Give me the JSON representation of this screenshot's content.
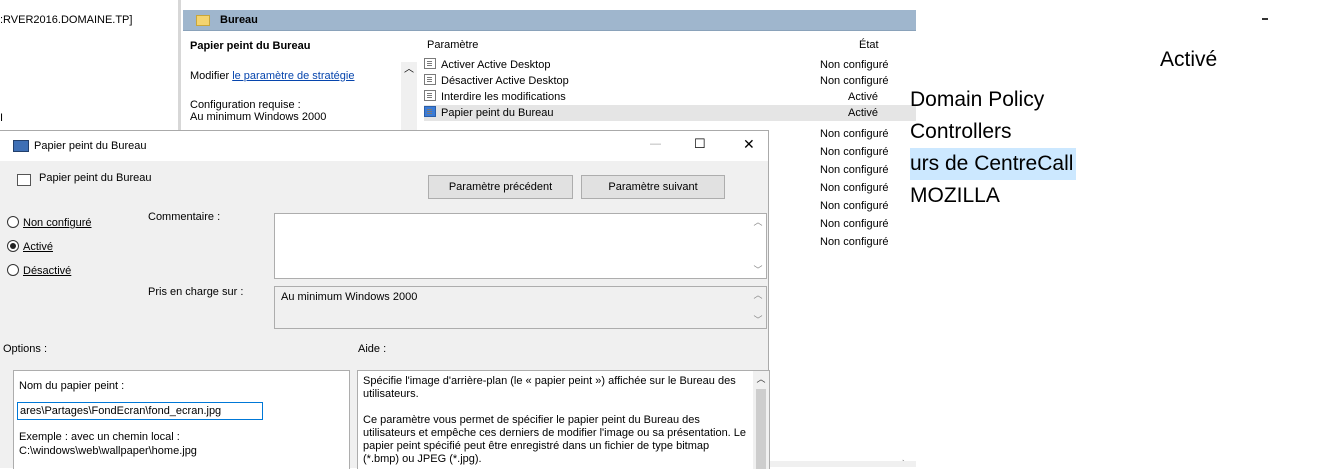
{
  "background": {
    "server_label": ":RVER2016.DOMAINE.TP]",
    "left_stub": "I",
    "folder_header": "Bureau",
    "desc_title": "Papier peint du Bureau",
    "desc_edit_prefix": "Modifier ",
    "desc_edit_link": "le paramètre de stratégie",
    "desc_req_label": "Configuration requise :",
    "desc_req_value": "Au minimum Windows 2000",
    "col_param": "Paramètre",
    "col_state": "État",
    "policies": [
      {
        "name": "Activer Active Desktop",
        "state": "Non configuré"
      },
      {
        "name": "Désactiver Active Desktop",
        "state": "Non configuré"
      },
      {
        "name": "Interdire les modifications",
        "state": "Activé"
      },
      {
        "name": "Papier peint du Bureau",
        "state": "Activé"
      }
    ],
    "extra_states": [
      "Non configuré",
      "Non configuré",
      "Non configuré",
      "Non configuré",
      "Non configuré",
      "Non configuré",
      "Non configuré"
    ],
    "gpo_list": [
      "Domain Policy",
      "Controllers",
      "urs de CentreCall",
      "MOZILLA"
    ],
    "big_state": "Activé",
    "accent": "#cce8ff",
    "header_color": "#9fb6cd"
  },
  "dialog": {
    "title": "Papier peint du Bureau",
    "setting_name": "Papier peint du Bureau",
    "prev_button": "Paramètre précédent",
    "next_button": "Paramètre suivant",
    "radio_not_configured": "Non configuré",
    "radio_enabled": "Activé",
    "radio_disabled": "Désactivé",
    "comment_label": "Commentaire :",
    "comment_value": "",
    "supported_label": "Pris en charge sur :",
    "supported_value": "Au minimum Windows 2000",
    "options_label": "Options :",
    "help_label": "Aide :",
    "wallpaper_label": "Nom du papier peint :",
    "wallpaper_value": "ares\\Partages\\FondEcran\\fond_ecran.jpg",
    "example_label": "Exemple : avec un chemin local :",
    "example_value": "C:\\windows\\web\\wallpaper\\home.jpg",
    "help_p1": "Spécifie l'image d'arrière-plan (le « papier peint ») affichée sur le Bureau des utilisateurs.",
    "help_p2": "Ce paramètre vous permet de spécifier le papier peint du Bureau des utilisateurs et empêche ces derniers de modifier l'image ou sa présentation. Le papier peint spécifié peut être enregistré dans un fichier de type bitmap (*.bmp) ou JPEG (*.jpg).",
    "minimize_glyph": "—",
    "maximize_glyph": "☐",
    "close_glyph": "✕"
  }
}
